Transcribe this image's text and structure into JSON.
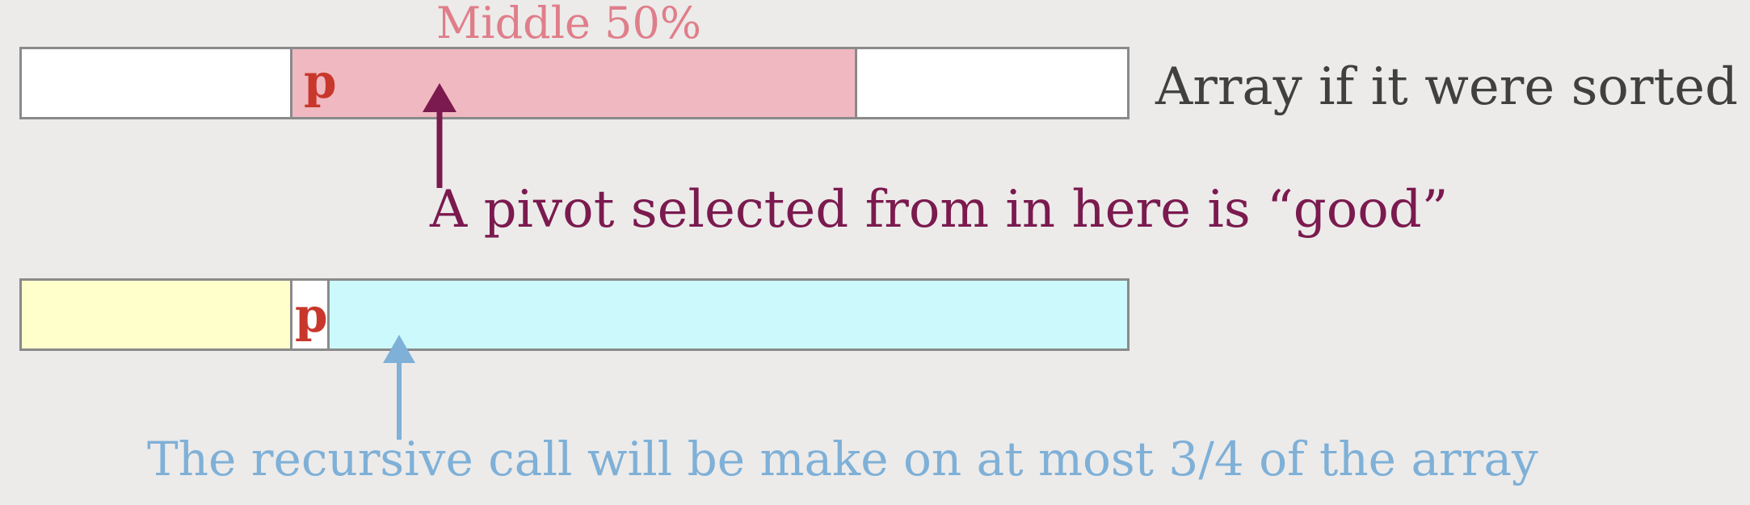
{
  "labels": {
    "middle": "Middle 50%",
    "pivot_top": "p",
    "sorted_caption": "Array if it were sorted",
    "good_caption": "A pivot selected from in here is “good”",
    "pivot_bottom": "p",
    "recursive_caption": "The recursive call will be make on at most 3/4 of the array"
  },
  "colors": {
    "background": "#ecebea",
    "bar_border": "#8a8a8a",
    "white_segment": "#ffffff",
    "middle_segment": "#f0b8c1",
    "left_partition": "#ffffcc",
    "right_partition": "#ccf9fb",
    "pivot_label": "#c8372c",
    "middle_label": "#df7e8a",
    "purple_arrow": "#7b1a4f",
    "blue_arrow": "#7fb0d7"
  }
}
